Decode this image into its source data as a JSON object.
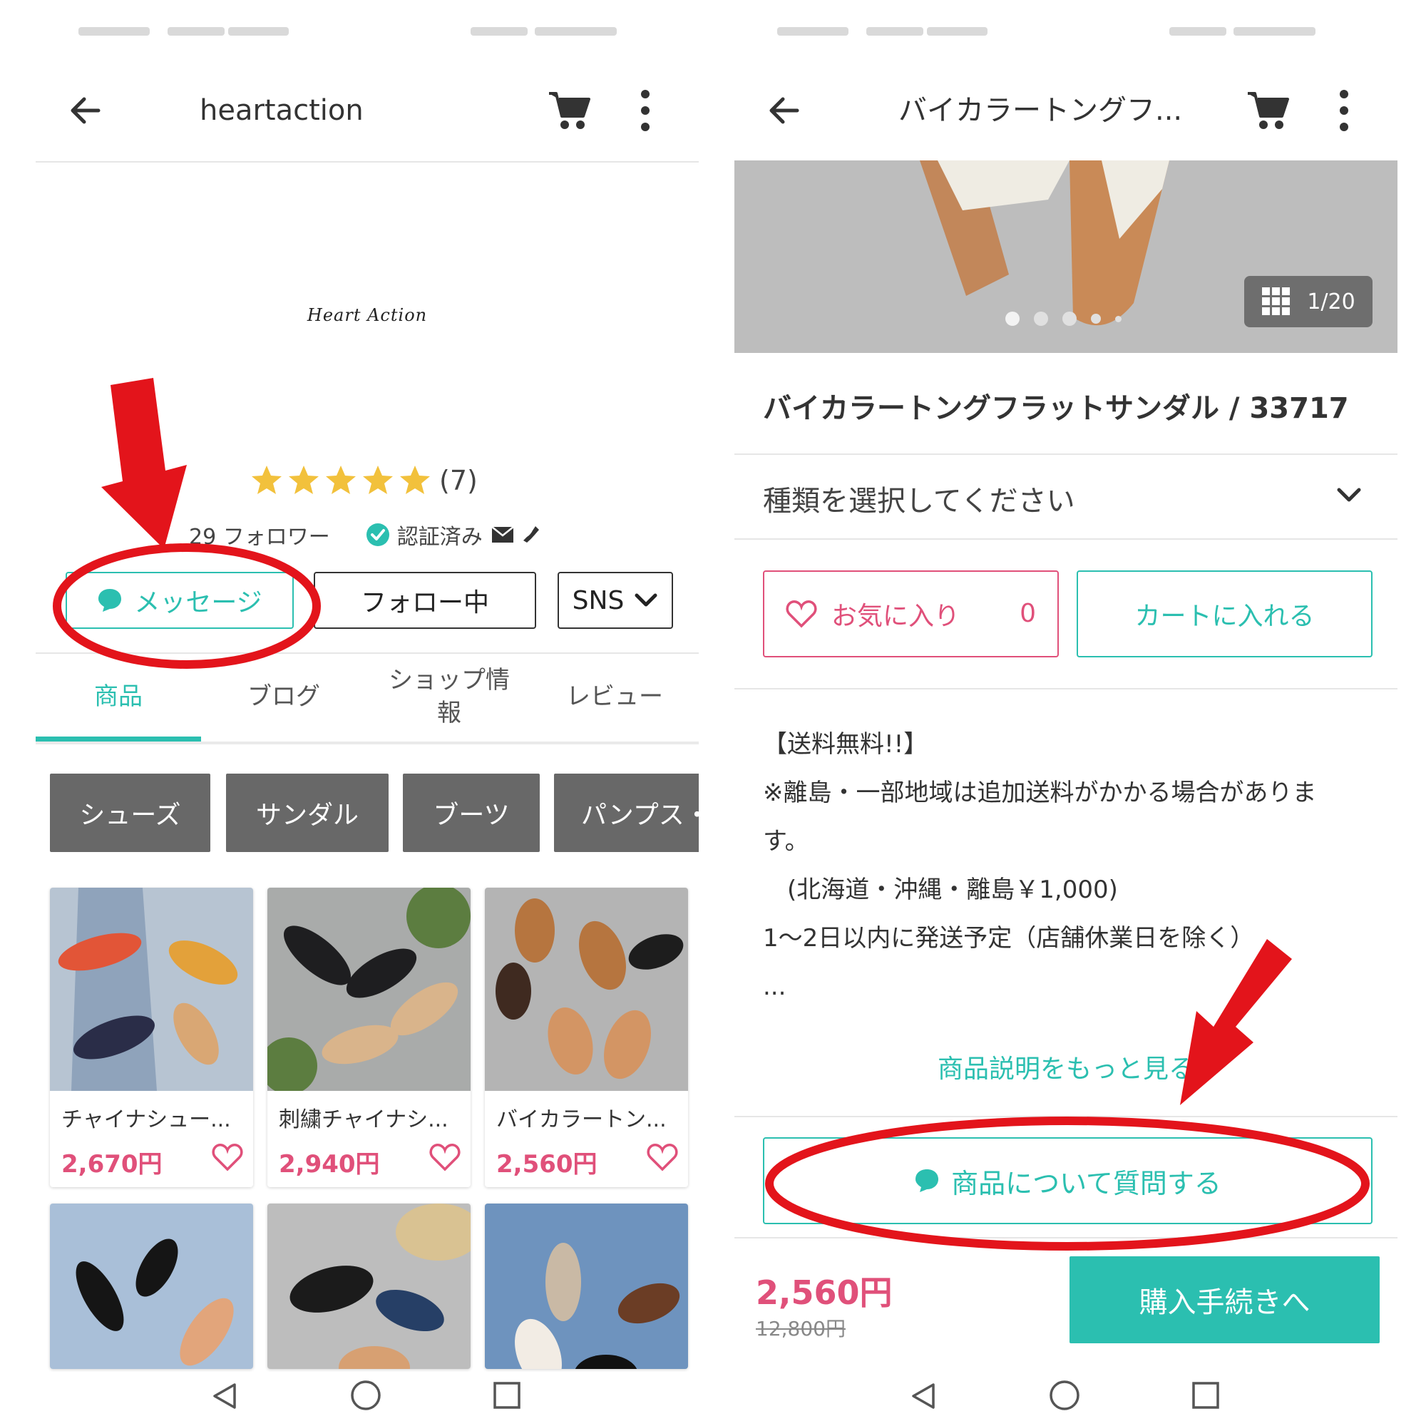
{
  "colors": {
    "accent_teal": "#2bbfb0",
    "price_pink": "#e0507a",
    "chip_gray": "#686868",
    "annotation_red": "#e3141b",
    "star_yellow": "#f2c13c"
  },
  "shop_screen": {
    "header": {
      "title": "heartaction",
      "back_icon": "arrow-left-icon",
      "cart_icon": "cart-icon",
      "more_icon": "more-vertical-icon"
    },
    "logo_text": "Heart Action",
    "rating": {
      "stars": 5,
      "count": "(7)"
    },
    "followers": "29 フォロワー",
    "verified": "認証済み",
    "buttons": {
      "message": "メッセージ",
      "follow": "フォロー中",
      "sns": "SNS"
    },
    "tabs": [
      {
        "label": "商品",
        "active": true
      },
      {
        "label": "ブログ",
        "active": false
      },
      {
        "label": "ショップ情\n報",
        "active": false
      },
      {
        "label": "レビュー",
        "active": false
      }
    ],
    "categories": [
      "シューズ",
      "サンダル",
      "ブーツ",
      "パンプス・"
    ],
    "products": [
      {
        "name": "チャイナシュー...",
        "price": "2,670円"
      },
      {
        "name": "刺繍チャイナシ...",
        "price": "2,940円"
      },
      {
        "name": "バイカラートン...",
        "price": "2,560円"
      }
    ]
  },
  "product_screen": {
    "header": {
      "title": "バイカラートングフ...",
      "back_icon": "arrow-left-icon",
      "cart_icon": "cart-icon",
      "more_icon": "more-vertical-icon"
    },
    "image_counter": "1/20",
    "product_title": "バイカラートングフラットサンダル / 33717",
    "variant_placeholder": "種類を選択してください",
    "favorite": {
      "label": "お気に入り",
      "count": "0"
    },
    "add_to_cart": "カートに入れる",
    "description": "【送料無料!!】\n※離島・一部地域は追加送料がかかる場合がありま\nす。\n　(北海道・沖縄・離島￥1,000)\n1〜2日以内に発送予定（店舗休業日を除く）\n...",
    "more_description": "商品説明をもっと見る",
    "ask_question": "商品について質問する",
    "price": "2,560円",
    "original_price": "12,800円",
    "checkout": "購入手続きへ"
  }
}
